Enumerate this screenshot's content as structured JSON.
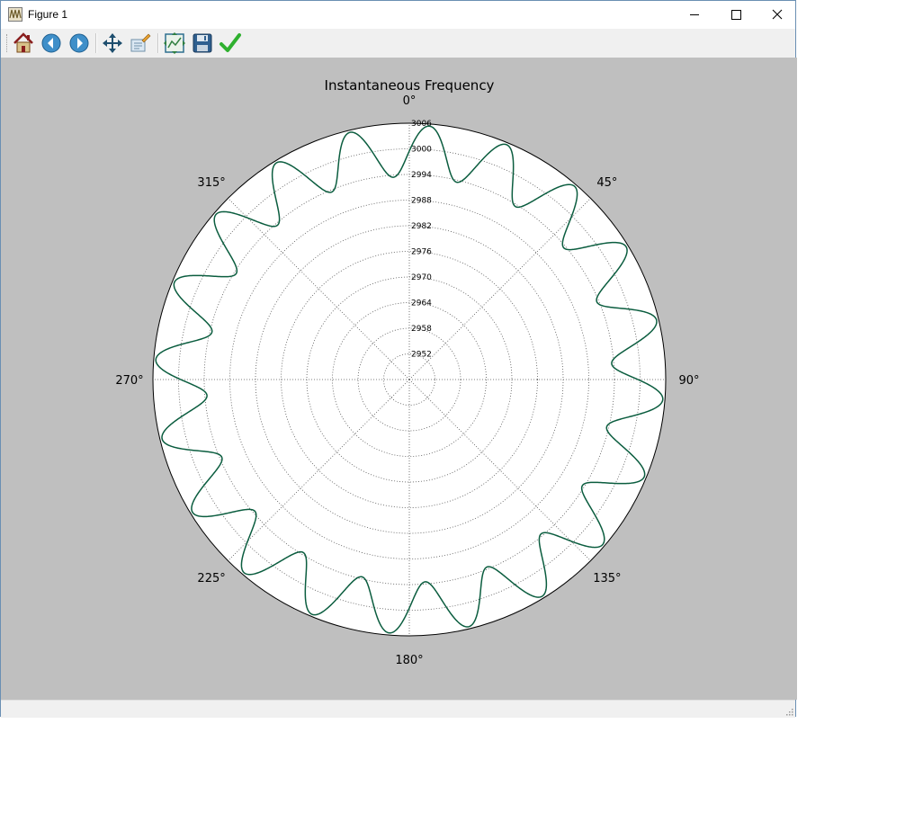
{
  "window": {
    "title": "Figure 1",
    "controls": [
      "minimize",
      "maximize",
      "close"
    ]
  },
  "toolbar": {
    "buttons": [
      {
        "name": "home",
        "icon": "home-icon"
      },
      {
        "name": "back",
        "icon": "arrow-left-icon"
      },
      {
        "name": "forward",
        "icon": "arrow-right-icon"
      },
      {
        "name": "pan",
        "icon": "move-arrows-icon"
      },
      {
        "name": "zoom",
        "icon": "zoom-rect-icon"
      },
      {
        "name": "subplots",
        "icon": "subplots-config-icon"
      },
      {
        "name": "save",
        "icon": "floppy-disk-icon"
      },
      {
        "name": "edit",
        "icon": "checkmark-icon"
      }
    ]
  },
  "colors": {
    "figure_bg": "#bfbfbf",
    "axes_bg": "#ffffff",
    "line": "#0b5d3f",
    "grid": "#555555"
  },
  "chart_data": {
    "type": "line",
    "projection": "polar",
    "title": "Instantaneous Frequency",
    "theta_direction": "clockwise",
    "theta_zero_location": "top",
    "theta_ticks": [
      "0°",
      "45°",
      "90°",
      "135°",
      "180°",
      "225°",
      "270°",
      "315°"
    ],
    "r_ticks": [
      2952,
      2958,
      2964,
      2970,
      2976,
      2982,
      2988,
      2994,
      3000,
      3006
    ],
    "rlim": [
      2946,
      3006
    ],
    "grid": true,
    "series": [
      {
        "color": "#0b5d3f",
        "theta_range_deg": [
          90,
          450
        ],
        "r_mean": 2999.5,
        "r_amplitude": 6,
        "cycles": 20,
        "r_at_theta_90_start": 2999.5
      }
    ]
  }
}
